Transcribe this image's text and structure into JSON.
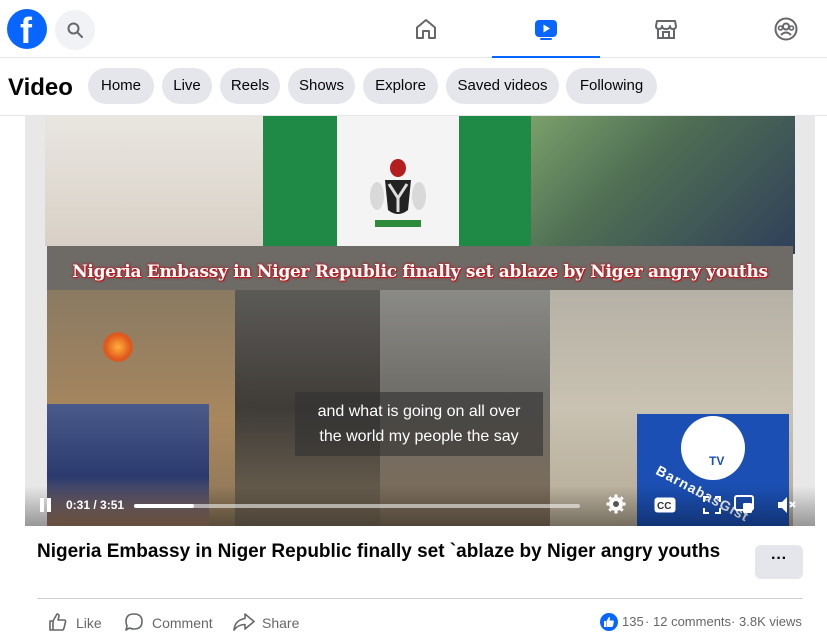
{
  "topnav": {
    "logo": "f",
    "tabs": [
      {
        "name": "home",
        "icon": "home-icon"
      },
      {
        "name": "video",
        "icon": "video-icon",
        "active": true
      },
      {
        "name": "marketplace",
        "icon": "marketplace-icon"
      },
      {
        "name": "groups",
        "icon": "groups-icon"
      }
    ],
    "accent": "#0866ff"
  },
  "video_header": {
    "title": "Video",
    "pills": [
      "Home",
      "Live",
      "Reels",
      "Shows",
      "Explore",
      "Saved videos",
      "Following"
    ]
  },
  "player": {
    "overlay_headline": "Nigeria Embassy in Niger Republic finally set ablaze  by Niger angry youths",
    "caption_line1": "and what is going on all over",
    "caption_line2": "the world my people the say",
    "channel_watermark": "BarnabasGist",
    "watermark_tv": "TV",
    "time": "0:31 / 3:51",
    "progress_fraction": 0.135,
    "headline_color": "#c0161b"
  },
  "post": {
    "title": "Nigeria Embassy in Niger Republic finally set `ablaze by Niger angry youths",
    "more_label": "···",
    "actions": {
      "like": "Like",
      "comment": "Comment",
      "share": "Share"
    },
    "stats": {
      "likes": "135",
      "comments": "12 comments",
      "views": "3.8K views",
      "sep": "·"
    }
  }
}
